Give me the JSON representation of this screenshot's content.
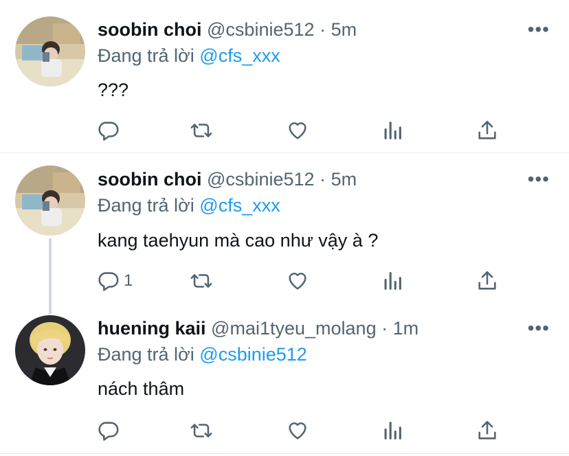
{
  "tweets": [
    {
      "name": "soobin choi",
      "handle": "@csbinie512",
      "dot": "·",
      "time": "5m",
      "reply_prefix": "Đang trả lời",
      "reply_mention": "@cfs_xxx",
      "text": "???",
      "reply_count": "",
      "avatar": "avatar-soobin"
    },
    {
      "name": "soobin choi",
      "handle": "@csbinie512",
      "dot": "·",
      "time": "5m",
      "reply_prefix": "Đang trả lời",
      "reply_mention": "@cfs_xxx",
      "text": "kang taehyun mà cao như vậy à ?",
      "reply_count": "1",
      "avatar": "avatar-soobin"
    },
    {
      "name": "huening kaii",
      "handle": "@mai1tyeu_molang",
      "dot": "·",
      "time": "1m",
      "reply_prefix": "Đang trả lời",
      "reply_mention": "@csbinie512",
      "text": "nách thâm",
      "reply_count": "",
      "avatar": "avatar-kai"
    }
  ],
  "more_glyph": "•••",
  "colors": {
    "link": "#1d9bf0",
    "secondary": "#536471",
    "divider": "#e6e9eb"
  },
  "icons": [
    "reply-icon",
    "retweet-icon",
    "like-icon",
    "analytics-icon",
    "share-icon",
    "more-icon"
  ]
}
